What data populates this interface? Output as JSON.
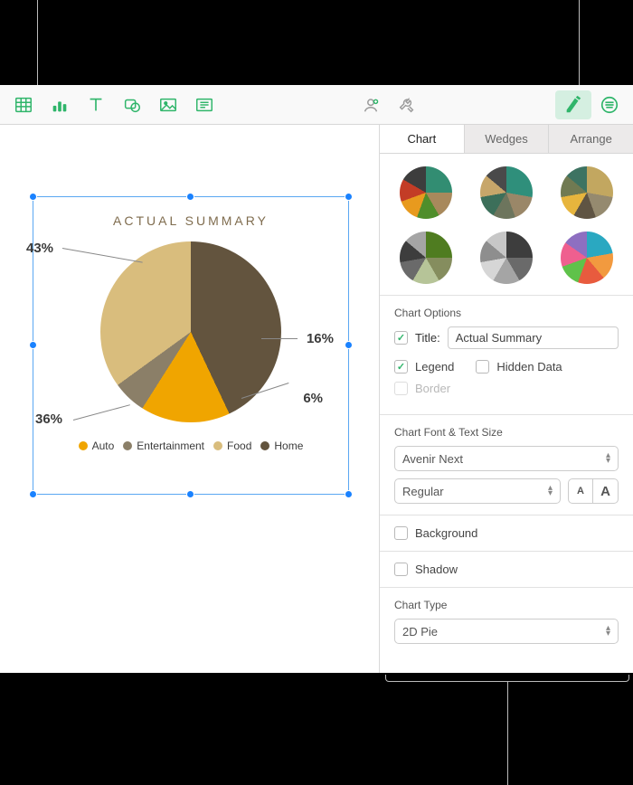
{
  "toolbar": {
    "icons": [
      "table",
      "chart",
      "text",
      "shape",
      "media",
      "comment",
      "collab",
      "tools",
      "format",
      "document"
    ]
  },
  "tabs": [
    "Chart",
    "Wedges",
    "Arrange"
  ],
  "active_tab": 0,
  "chart_options": {
    "section_title": "Chart Options",
    "title_label": "Title:",
    "title_value": "Actual Summary",
    "legend_label": "Legend",
    "hidden_data_label": "Hidden Data",
    "border_label": "Border",
    "title_checked": true,
    "legend_checked": true,
    "hidden_checked": false,
    "border_checked": false
  },
  "font_section": {
    "title": "Chart Font & Text Size",
    "font_family": "Avenir Next",
    "font_weight": "Regular",
    "small_A": "A",
    "big_A": "A"
  },
  "background": {
    "label": "Background",
    "checked": false
  },
  "shadow": {
    "label": "Shadow",
    "checked": false
  },
  "chart_type_section": {
    "title": "Chart Type",
    "value": "2D Pie"
  },
  "chart_data": {
    "type": "pie",
    "title": "ACTUAL SUMMARY",
    "series": [
      {
        "name": "Auto",
        "value": 16,
        "color": "#f0a500"
      },
      {
        "name": "Entertainment",
        "value": 6,
        "color": "#8b7f68"
      },
      {
        "name": "Food",
        "value": 36,
        "color": "#d9bd7d"
      },
      {
        "name": "Home",
        "value": 43,
        "color": "#63543e"
      }
    ],
    "labels": [
      "43%",
      "16%",
      "6%",
      "36%"
    ]
  },
  "style_presets": [
    {
      "seg": [
        "#328d72",
        "#a8895c",
        "#4f8e2b",
        "#e89a1e",
        "#c33c26",
        "#3d3d3d"
      ]
    },
    {
      "seg": [
        "#2f8f7b",
        "#9a8768",
        "#6d755d",
        "#3c6f5a",
        "#c7a66a",
        "#4a4a4a"
      ]
    },
    {
      "seg": [
        "#c2a760",
        "#958a6f",
        "#5f5443",
        "#e7b53d",
        "#707a52",
        "#3d7362"
      ]
    },
    {
      "seg": [
        "#4f7c20",
        "#858d5e",
        "#b6c498",
        "#6a6a6a",
        "#3d3d3d",
        "#a5a5a5"
      ]
    },
    {
      "seg": [
        "#3d3d3d",
        "#6a6a6a",
        "#a5a5a5",
        "#d6d6d6",
        "#8e8e8e",
        "#c7c7c7"
      ]
    },
    {
      "seg": [
        "#2aa8c1",
        "#f29a3f",
        "#e85b3e",
        "#5fc24a",
        "#ef5f8f",
        "#8e6fc1"
      ]
    }
  ]
}
